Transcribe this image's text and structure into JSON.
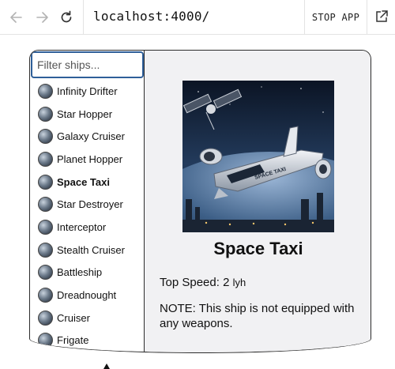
{
  "browser": {
    "url": "localhost:4000/",
    "stop_label": "STOP APP"
  },
  "app": {
    "filter_placeholder": "Filter ships...",
    "ships": [
      {
        "name": "Infinity Drifter",
        "active": false
      },
      {
        "name": "Star Hopper",
        "active": false
      },
      {
        "name": "Galaxy Cruiser",
        "active": false
      },
      {
        "name": "Planet Hopper",
        "active": false
      },
      {
        "name": "Space Taxi",
        "active": true
      },
      {
        "name": "Star Destroyer",
        "active": false
      },
      {
        "name": "Interceptor",
        "active": false
      },
      {
        "name": "Stealth Cruiser",
        "active": false
      },
      {
        "name": "Battleship",
        "active": false
      },
      {
        "name": "Dreadnought",
        "active": false
      },
      {
        "name": "Cruiser",
        "active": false
      },
      {
        "name": "Frigate",
        "active": false
      }
    ],
    "detail": {
      "name": "Space Taxi",
      "speed_label": "Top Speed:",
      "speed_value": "2",
      "speed_unit": "lyh",
      "note": "NOTE: This ship is not equipped with any weapons.",
      "image_text": "SPACE TAXI"
    }
  },
  "colors": {
    "focus_border": "#2f5f99",
    "detail_bg": "#f1f1f3"
  }
}
